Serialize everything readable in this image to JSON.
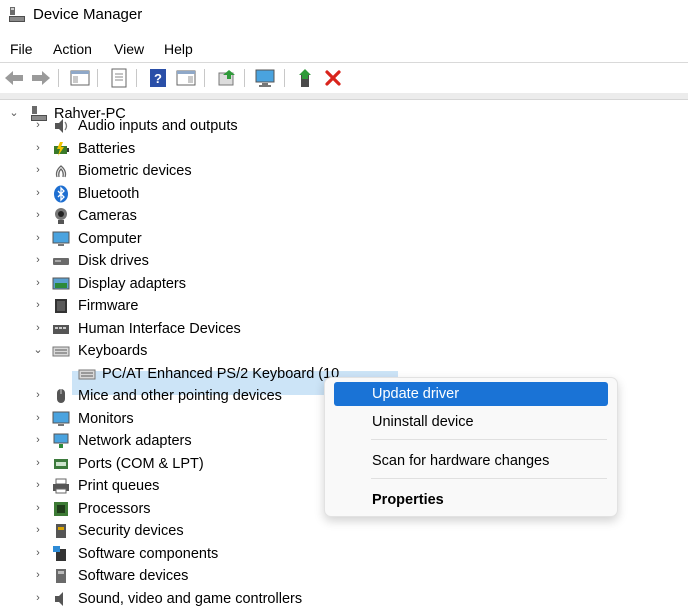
{
  "window": {
    "title": "Device Manager"
  },
  "menu": [
    "File",
    "Action",
    "View",
    "Help"
  ],
  "tree": {
    "root": "Rahver-PC",
    "categories": [
      {
        "label": "Audio inputs and outputs",
        "icon": "speaker-icon"
      },
      {
        "label": "Batteries",
        "icon": "battery-icon"
      },
      {
        "label": "Biometric devices",
        "icon": "fingerprint-icon"
      },
      {
        "label": "Bluetooth",
        "icon": "bluetooth-icon"
      },
      {
        "label": "Cameras",
        "icon": "camera-icon"
      },
      {
        "label": "Computer",
        "icon": "monitor-icon"
      },
      {
        "label": "Disk drives",
        "icon": "disk-drive-icon"
      },
      {
        "label": "Display adapters",
        "icon": "display-adapter-icon"
      },
      {
        "label": "Firmware",
        "icon": "chip-icon"
      },
      {
        "label": "Human Interface Devices",
        "icon": "hid-icon"
      },
      {
        "label": "Keyboards",
        "icon": "keyboard-icon",
        "expanded": true
      },
      {
        "label": "Mice and other pointing devices",
        "icon": "mouse-icon"
      },
      {
        "label": "Monitors",
        "icon": "monitor-icon"
      },
      {
        "label": "Network adapters",
        "icon": "network-icon"
      },
      {
        "label": "Ports (COM & LPT)",
        "icon": "port-icon"
      },
      {
        "label": "Print queues",
        "icon": "printer-icon"
      },
      {
        "label": "Processors",
        "icon": "processor-icon"
      },
      {
        "label": "Security devices",
        "icon": "security-icon"
      },
      {
        "label": "Software components",
        "icon": "software-components-icon"
      },
      {
        "label": "Software devices",
        "icon": "software-devices-icon"
      },
      {
        "label": "Sound, video and game controllers",
        "icon": "sound-icon"
      }
    ],
    "keyboard_child": "PC/AT Enhanced PS/2 Keyboard (10"
  },
  "context_menu": {
    "items": [
      "Update driver",
      "Uninstall device",
      "Scan for hardware changes",
      "Properties"
    ]
  },
  "colors": {
    "selection": "#cce4f7",
    "highlight": "#1a73d6",
    "red_x": "#d9241c"
  }
}
